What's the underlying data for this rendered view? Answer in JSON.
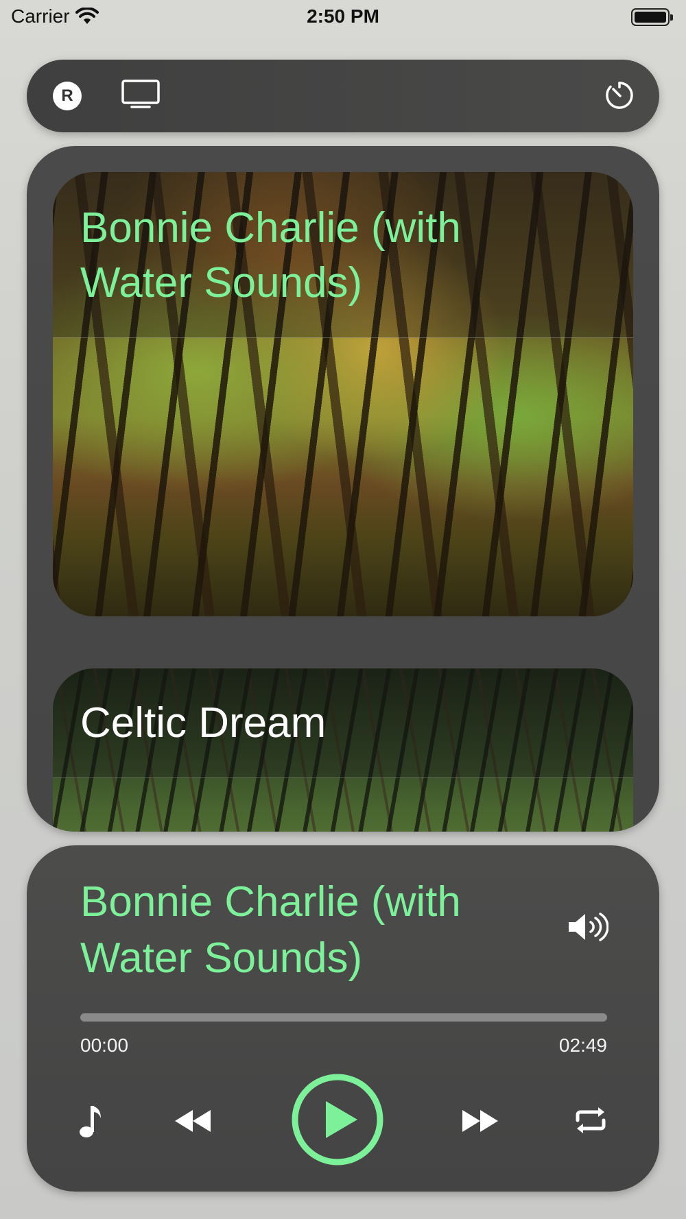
{
  "status_bar": {
    "carrier": "Carrier",
    "time": "2:50 PM"
  },
  "top_bar": {
    "account_letter": "R",
    "icons": [
      "account-icon",
      "tv-icon",
      "timer-icon"
    ]
  },
  "library": {
    "tracks": [
      {
        "title": "Bonnie Charlie (with Water Sounds)",
        "selected": true
      },
      {
        "title": "Celtic Dream",
        "selected": false
      }
    ]
  },
  "player": {
    "now_playing_title": "Bonnie Charlie (with Water Sounds)",
    "elapsed": "00:00",
    "duration": "02:49",
    "progress_fraction": 0.0,
    "icons": [
      "music-note-icon",
      "rewind-icon",
      "play-icon",
      "fast-forward-icon",
      "repeat-icon",
      "volume-icon"
    ]
  },
  "colors": {
    "accent": "#7DF09A",
    "panel": "#4A4A4A"
  }
}
